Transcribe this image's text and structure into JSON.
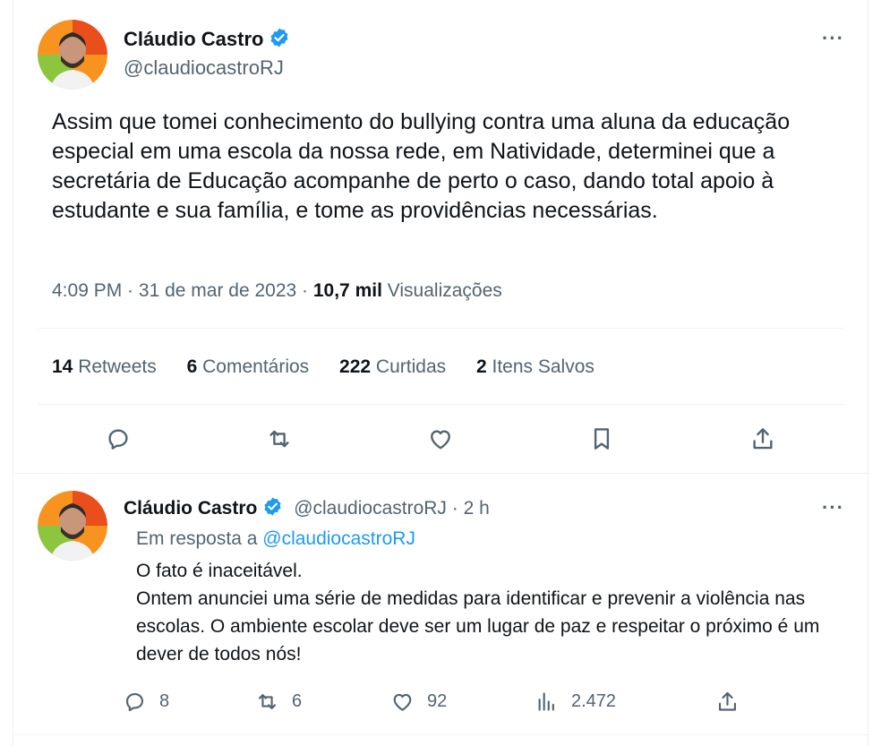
{
  "main_tweet": {
    "author_name": "Cláudio Castro",
    "author_handle": "@claudiocastroRJ",
    "more_label": "···",
    "text": "Assim que tomei conhecimento do bullying contra uma aluna da educação especial em uma escola da nossa rede, em Natividade, determinei que a secretária de Educação acompanhe de perto o caso, dando total apoio à estudante e sua família, e tome as providências necessárias.",
    "time": "4:09 PM",
    "date": "31 de mar de 2023",
    "views_count": "10,7 mil",
    "views_label": "Visualizações",
    "stats": {
      "retweets_count": "14",
      "retweets_label": "Retweets",
      "comments_count": "6",
      "comments_label": "Comentários",
      "likes_count": "222",
      "likes_label": "Curtidas",
      "saved_count": "2",
      "saved_label": "Itens Salvos"
    }
  },
  "reply_tweet": {
    "author_name": "Cláudio Castro",
    "author_handle": "@claudiocastroRJ",
    "time_ago": "2 h",
    "more_label": "···",
    "reply_prefix": "Em resposta a",
    "reply_to": "@claudiocastroRJ",
    "line1": "O fato é inaceitável.",
    "line2": "Ontem anunciei uma série de medidas para identificar e prevenir a violência nas escolas. O ambiente escolar deve ser um lugar de paz e respeitar o próximo é um dever de todos nós!",
    "counts": {
      "replies": "8",
      "retweets": "6",
      "likes": "92",
      "views": "2.472"
    }
  },
  "colors": {
    "text": "#0f1419",
    "secondary": "#536471",
    "accent": "#1d9bf0",
    "border": "#eff3f4"
  },
  "icons": [
    "verified-badge-icon",
    "more-icon",
    "reply-icon",
    "retweet-icon",
    "like-icon",
    "bookmark-icon",
    "share-icon",
    "views-icon"
  ]
}
